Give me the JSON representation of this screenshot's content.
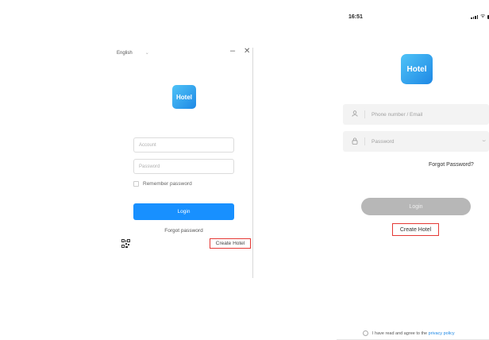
{
  "desktop": {
    "language": "English",
    "logo_text": "Hotel",
    "account_placeholder": "Account",
    "password_placeholder": "Password",
    "remember_label": "Remember password",
    "login_label": "Login",
    "forgot_label": "Forgot password",
    "create_hotel_label": "Create Hotel"
  },
  "mobile": {
    "time": "16:51",
    "logo_text": "Hotel",
    "phone_placeholder": "Phone number / Email",
    "password_placeholder": "Password",
    "forgot_label": "Forgot Password?",
    "login_label": "Login",
    "create_hotel_label": "Create Hotel",
    "agree_text": "I have read and agree to the ",
    "privacy_link": "privacy policy"
  },
  "colors": {
    "primary": "#1890ff",
    "highlight": "#e53935",
    "disabled_button": "#b7b7b7"
  },
  "icons": [
    "chevron-down-icon",
    "minimize-icon",
    "close-icon",
    "qr-code-icon",
    "user-icon",
    "lock-icon",
    "eye-closed-icon",
    "signal-icon",
    "wifi-icon",
    "battery-icon"
  ]
}
